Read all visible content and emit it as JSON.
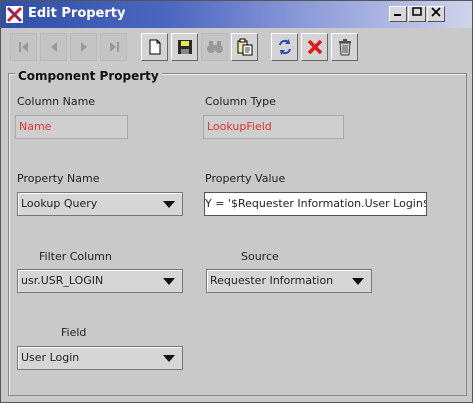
{
  "window": {
    "title": "Edit Property"
  },
  "toolbar": {
    "buttons": [
      {
        "name": "first-record-icon",
        "enabled": false
      },
      {
        "name": "previous-record-icon",
        "enabled": false
      },
      {
        "name": "next-record-icon",
        "enabled": false
      },
      {
        "name": "last-record-icon",
        "enabled": false
      },
      {
        "name": "new-document-icon",
        "enabled": true
      },
      {
        "name": "save-icon",
        "enabled": true
      },
      {
        "name": "find-binoculars-icon",
        "enabled": false
      },
      {
        "name": "paste-icon",
        "enabled": true
      },
      {
        "name": "refresh-icon",
        "enabled": true
      },
      {
        "name": "delete-x-icon",
        "enabled": true
      },
      {
        "name": "trash-icon",
        "enabled": true
      }
    ]
  },
  "group": {
    "title": "Component Property"
  },
  "fields": {
    "column_name": {
      "label": "Column Name",
      "value": "Name"
    },
    "column_type": {
      "label": "Column Type",
      "value": "LookupField"
    },
    "property_name": {
      "label": "Property Name",
      "value": "Lookup Query"
    },
    "property_value": {
      "label": "Property Value",
      "value": "Y = '$Requester Information.User Login$'"
    },
    "filter_column": {
      "label": "Filter Column",
      "value": "usr.USR_LOGIN"
    },
    "source": {
      "label": "Source",
      "value": "Requester Information"
    },
    "field": {
      "label": "Field",
      "value": "User Login"
    }
  },
  "colors": {
    "readonly_text": "#dd3333",
    "title_bar": "#2f4fa8"
  }
}
